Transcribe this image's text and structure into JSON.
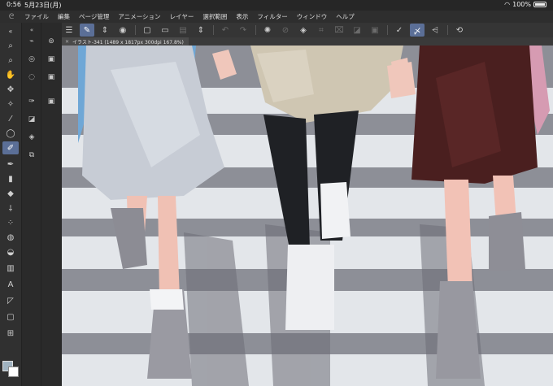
{
  "status": {
    "time": "0:56",
    "date": "5月23日(月)",
    "battery": "100%"
  },
  "menu": {
    "logo_icon": "clip-studio-logo-icon",
    "items": [
      "ファイル",
      "編集",
      "ページ管理",
      "アニメーション",
      "レイヤー",
      "選択範囲",
      "表示",
      "フィルター",
      "ウィンドウ",
      "ヘルプ"
    ]
  },
  "document": {
    "tab_title": "イラスト-341 (1489 x 1817px 300dpi 167.8%)"
  },
  "colors": {
    "accent": "#5b6f97",
    "main_color": "#9fb2c0",
    "sub_color": "#ffffff"
  },
  "canvas": {
    "subject": "three figures walking across a crosswalk"
  }
}
